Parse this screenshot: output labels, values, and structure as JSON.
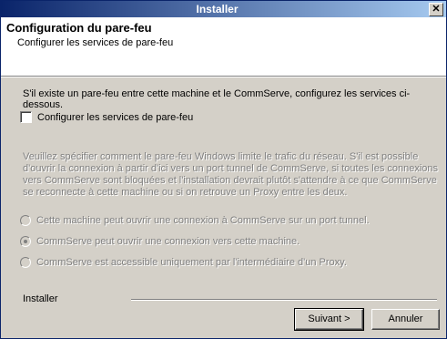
{
  "window": {
    "title": "Installer"
  },
  "header": {
    "title": "Configuration du pare-feu",
    "subtitle": "Configurer les services de pare-feu"
  },
  "intro_text": "S'il existe un pare-feu entre cette machine et le CommServe, configurez les services ci-dessous.",
  "checkbox": {
    "label": "Configurer les services de pare-feu",
    "checked": false
  },
  "description": [
    "Veuillez spécifier comment le pare-feu Windows limite le trafic du réseau. S'il est possible",
    "d'ouvrir la connexion à partir d'ici vers un port tunnel de CommServe, si toutes les connexions",
    "vers CommServe sont bloquées et l'installation devrait plutôt s'attendre à ce que CommServe",
    "se reconnecte à cette machine ou si on retrouve un Proxy entre les deux."
  ],
  "radio_options": [
    {
      "label": "Cette machine peut ouvrir une connexion à CommServe sur un port tunnel.",
      "selected": false
    },
    {
      "label": "CommServe peut ouvrir une connexion vers cette machine.",
      "selected": true
    },
    {
      "label": "CommServe est accessible uniquement par l'intermédiaire d'un Proxy.",
      "selected": false
    }
  ],
  "footer": {
    "label": "Installer"
  },
  "buttons": {
    "next": "Suivant >",
    "cancel": "Annuler"
  }
}
